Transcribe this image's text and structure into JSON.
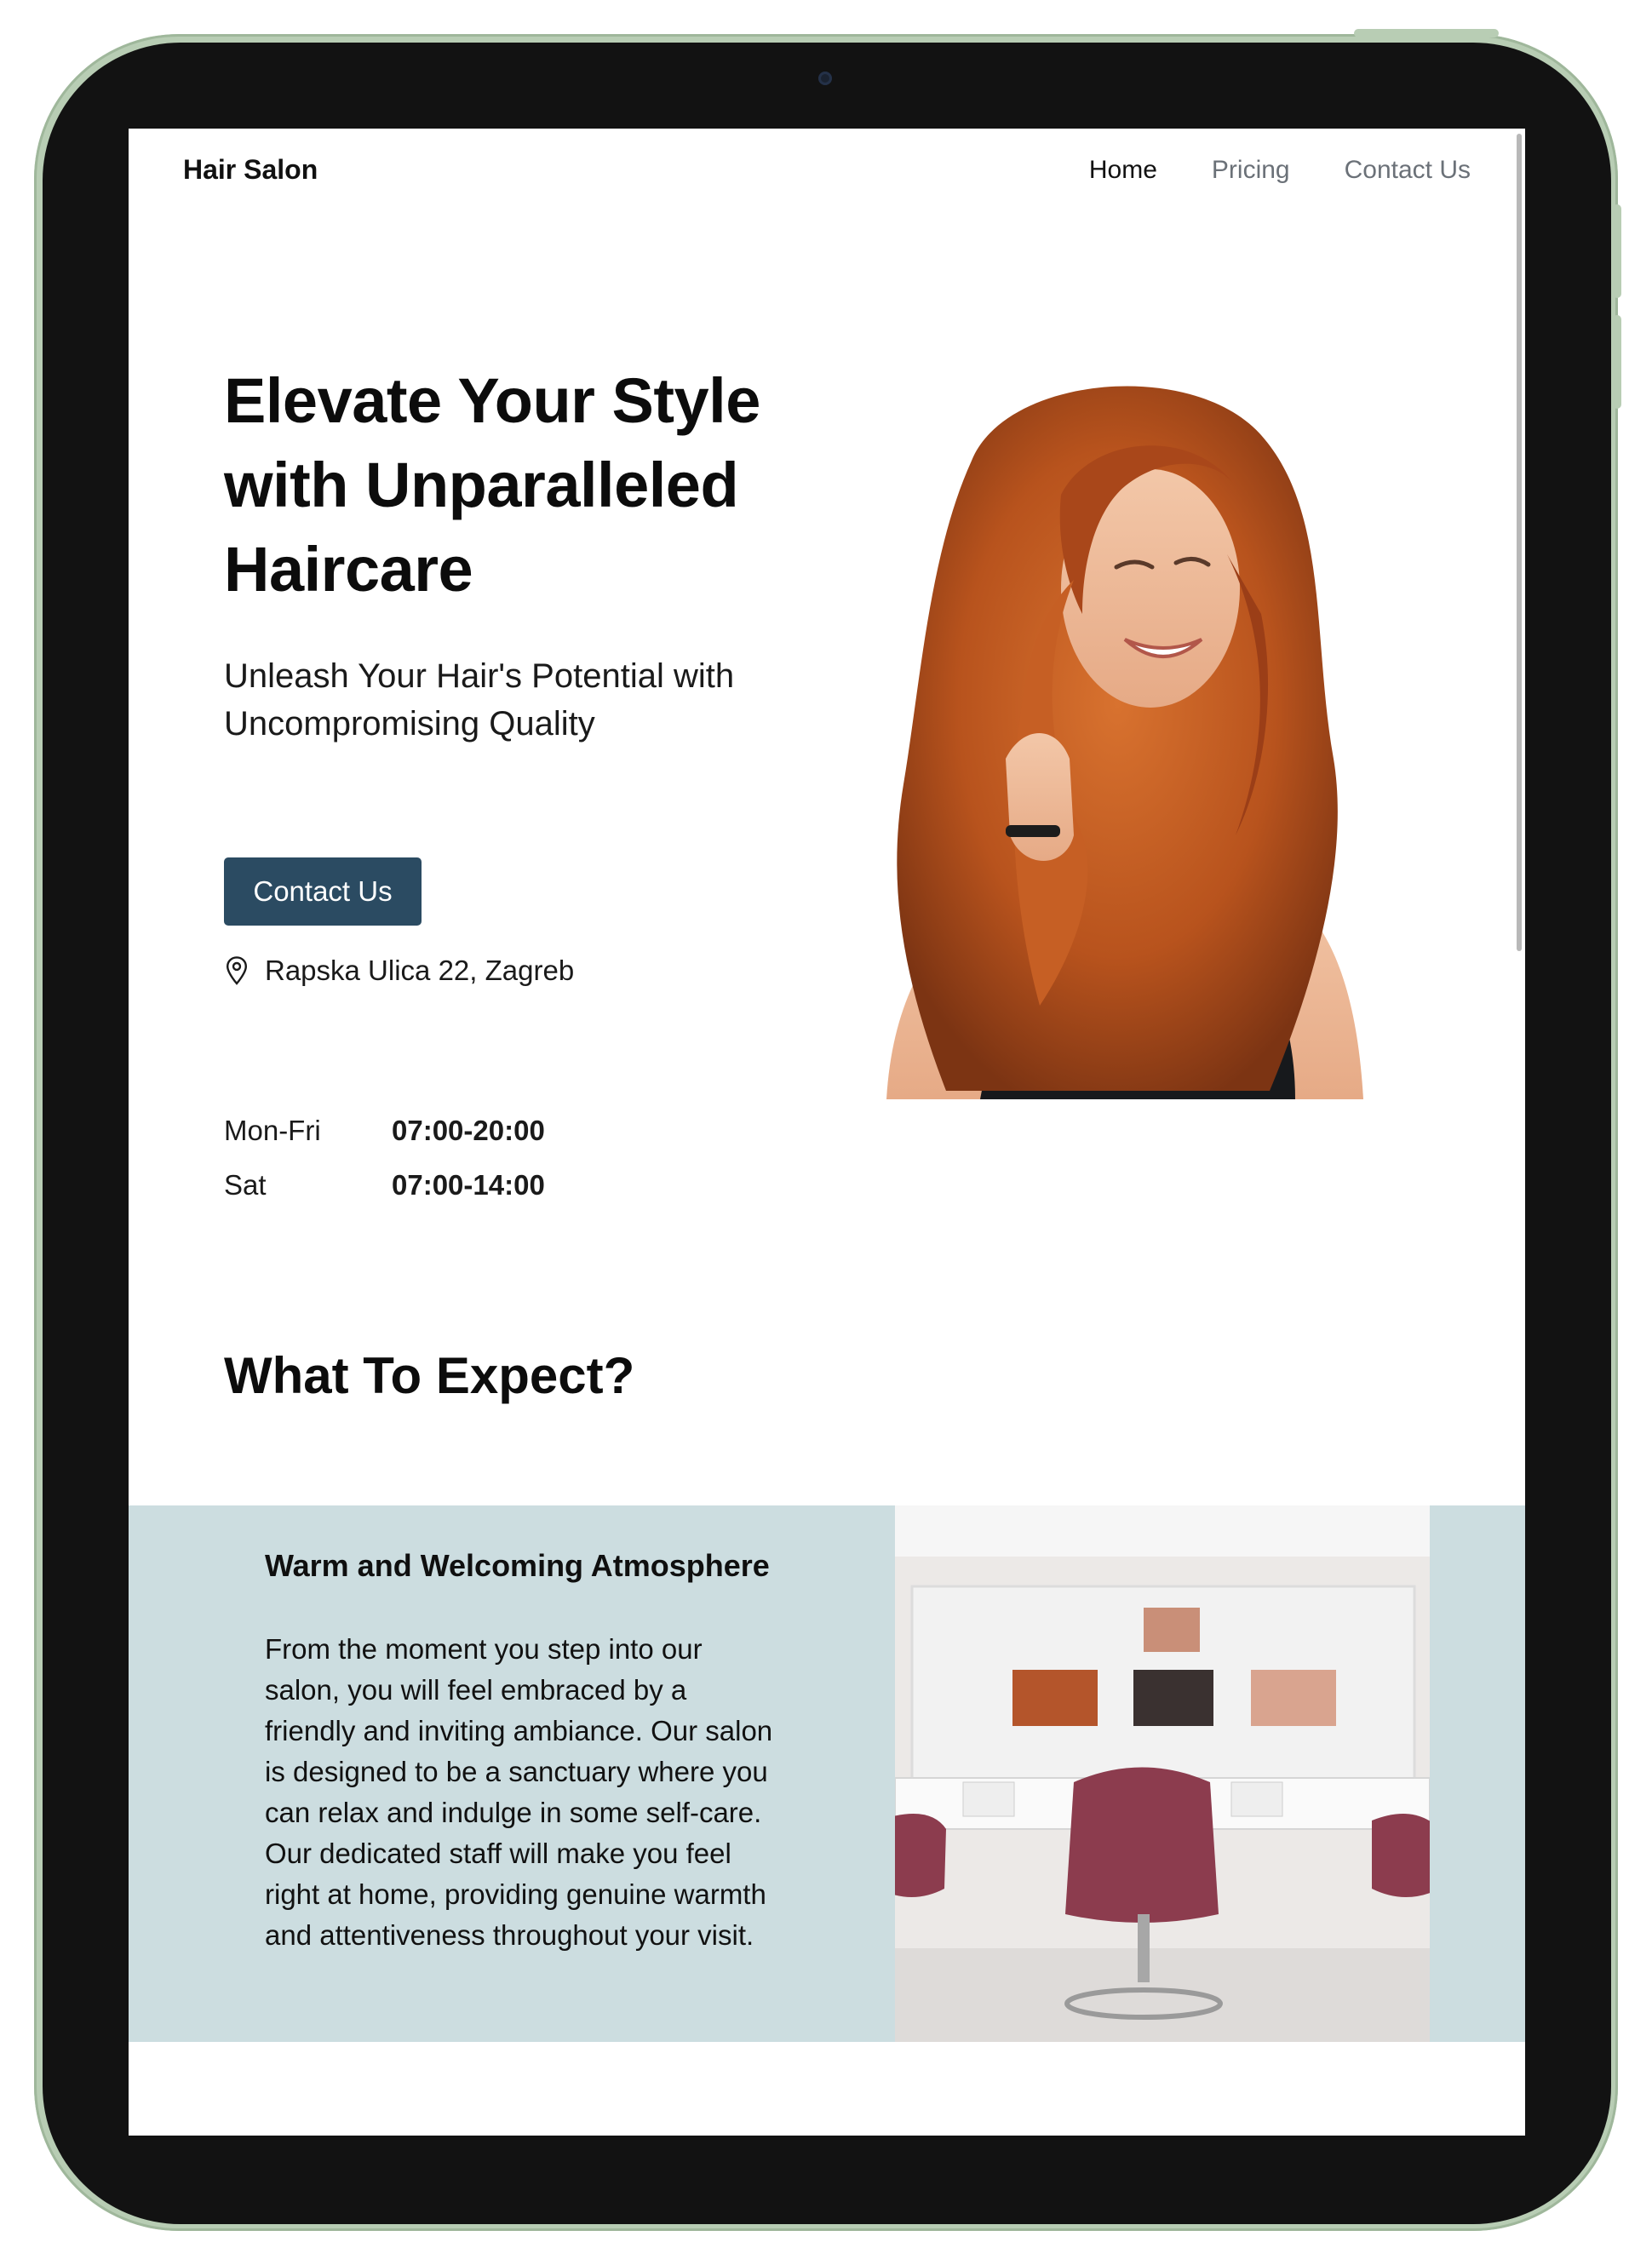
{
  "header": {
    "brand": "Hair Salon",
    "nav": [
      {
        "label": "Home",
        "active": true
      },
      {
        "label": "Pricing",
        "active": false
      },
      {
        "label": "Contact Us",
        "active": false
      }
    ]
  },
  "hero": {
    "title": "Elevate Your Style with Unparalleled Haircare",
    "subtitle": "Unleash Your Hair's Potential with Uncompromising Quality",
    "cta_label": "Contact Us",
    "address": "Rapska Ulica 22, Zagreb",
    "address_icon": "map-pin-icon",
    "hours": [
      {
        "day": "Mon-Fri",
        "time": "07:00-20:00"
      },
      {
        "day": "Sat",
        "time": "07:00-14:00"
      }
    ]
  },
  "section": {
    "title": "What To Expect?"
  },
  "feature": {
    "title": "Warm and Welcoming Atmosphere",
    "body": "From the moment you step into our salon, you will feel embraced by a friendly and inviting ambiance. Our salon is designed to be a sanctuary where you can relax and indulge in some self-care. Our dedicated staff will make you feel right at home, providing genuine warmth and attentiveness throughout your visit."
  },
  "colors": {
    "accent": "#2b4b62",
    "feature_band": "#ccdde0",
    "device_frame": "#b8cdb4",
    "bezel": "#121212"
  }
}
